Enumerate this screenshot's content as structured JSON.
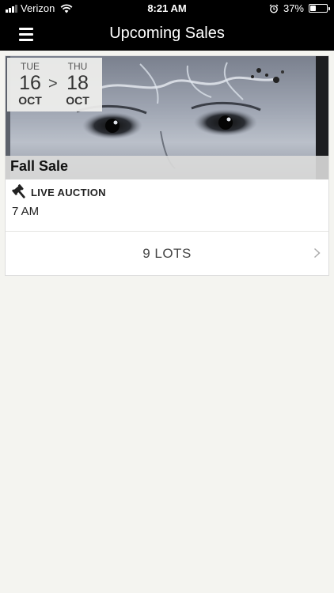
{
  "status_bar": {
    "carrier": "Verizon",
    "time": "8:21 AM",
    "battery_percent": "37%",
    "battery_level": 0.37,
    "icons": [
      "signal-icon",
      "wifi-icon",
      "alarm-icon",
      "battery-icon"
    ]
  },
  "nav": {
    "title": "Upcoming Sales",
    "menu_icon": "hamburger-menu-icon"
  },
  "sale": {
    "start": {
      "dow": "TUE",
      "day": "16",
      "month": "OCT"
    },
    "end": {
      "dow": "THU",
      "day": "18",
      "month": "OCT"
    },
    "range_separator": ">",
    "title": "Fall Sale",
    "auction_type": "LIVE AUCTION",
    "auction_icon": "gavel-icon",
    "time": "7 AM",
    "lots": "9 LOTS",
    "lots_icon": "chevron-right-icon"
  }
}
